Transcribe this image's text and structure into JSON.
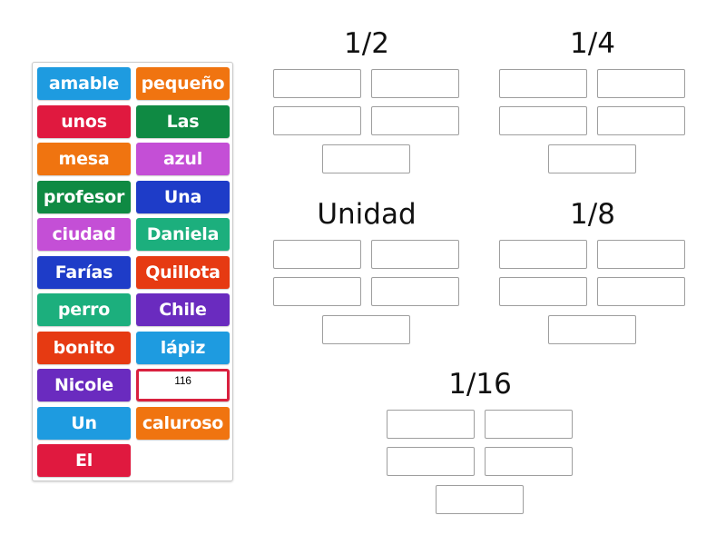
{
  "bank": {
    "tiles": [
      {
        "label": "amable",
        "color": "#1e9be0"
      },
      {
        "label": "pequeño",
        "color": "#f07410"
      },
      {
        "label": "unos",
        "color": "#e0193f"
      },
      {
        "label": "Las",
        "color": "#0f8a43"
      },
      {
        "label": "mesa",
        "color": "#f07410"
      },
      {
        "label": "azul",
        "color": "#c44fd6"
      },
      {
        "label": "profesor",
        "color": "#0f8a43"
      },
      {
        "label": "Una",
        "color": "#1e3cc8"
      },
      {
        "label": "ciudad",
        "color": "#c44fd6"
      },
      {
        "label": "Daniela",
        "color": "#1caf7d"
      },
      {
        "label": "Farías",
        "color": "#1e3cc8"
      },
      {
        "label": "Quillota",
        "color": "#e63a12"
      },
      {
        "label": "perro",
        "color": "#1caf7d"
      },
      {
        "label": "Chile",
        "color": "#6a2bbf"
      },
      {
        "label": "bonito",
        "color": "#e63a12"
      },
      {
        "label": "lápiz",
        "color": "#1e9be0"
      },
      {
        "label": "Nicole",
        "color": "#6a2bbf"
      },
      {
        "label": "116",
        "color": "#ffffff",
        "border": "#d9203f"
      },
      {
        "label": "Un",
        "color": "#1e9be0"
      },
      {
        "label": "caluroso",
        "color": "#f07410"
      },
      {
        "label": "El",
        "color": "#e0193f"
      }
    ]
  },
  "groups": [
    {
      "title": "1/2",
      "slots": 5
    },
    {
      "title": "1/4",
      "slots": 5
    },
    {
      "title": "Unidad",
      "slots": 5
    },
    {
      "title": "1/8",
      "slots": 5
    },
    {
      "title": "1/16",
      "slots": 5
    }
  ]
}
